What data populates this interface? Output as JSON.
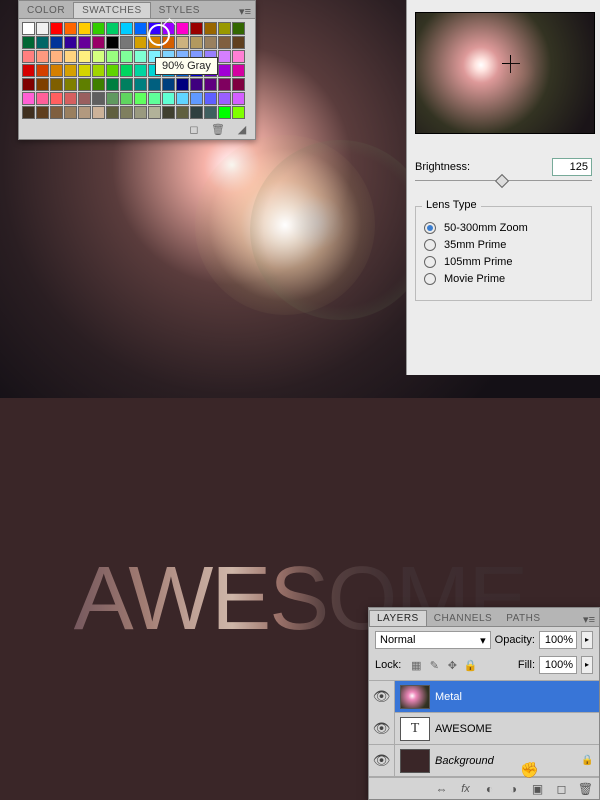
{
  "swatches": {
    "tabs": [
      "COLOR",
      "SWATCHES",
      "STYLES"
    ],
    "active_tab": 1,
    "tooltip": "90% Gray",
    "colors": [
      "#ffffff",
      "#f0f0f0",
      "#ff0000",
      "#ff6600",
      "#ffcc00",
      "#33cc00",
      "#00cc66",
      "#00ccff",
      "#0066ff",
      "#3300ff",
      "#9900ff",
      "#ff00cc",
      "#990000",
      "#996600",
      "#999900",
      "#336600",
      "#006633",
      "#006666",
      "#003399",
      "#330099",
      "#660099",
      "#990066",
      "#000000",
      "#777777",
      "#d4a000",
      "#d47f00",
      "#d45f00",
      "#ccb27f",
      "#b2995f",
      "#99805f",
      "#805f3f",
      "#5f3f1f",
      "#ff7f7f",
      "#ff997f",
      "#ffb27f",
      "#ffd47f",
      "#fff07f",
      "#d4ff7f",
      "#99ff7f",
      "#7fff99",
      "#7fffd4",
      "#7ff0ff",
      "#7fd4ff",
      "#7fb2ff",
      "#7f99ff",
      "#997fff",
      "#d47fff",
      "#ff7fd4",
      "#d40000",
      "#d43f00",
      "#d47f00",
      "#d4a000",
      "#d4d400",
      "#a0d400",
      "#5fd400",
      "#00d45f",
      "#00d4a0",
      "#00d4d4",
      "#00a0d4",
      "#005fd4",
      "#0000d4",
      "#5f00d4",
      "#a000d4",
      "#d400a0",
      "#7f0000",
      "#7f3f00",
      "#7f5f00",
      "#7f7f00",
      "#5f7f00",
      "#3f7f00",
      "#007f3f",
      "#007f5f",
      "#007f7f",
      "#005f7f",
      "#003f7f",
      "#00007f",
      "#3f007f",
      "#5f007f",
      "#7f005f",
      "#7f003f",
      "#ff5fd4",
      "#ff5f99",
      "#ff5f5f",
      "#d45f5f",
      "#995f5f",
      "#5f5f5f",
      "#5f995f",
      "#5fd45f",
      "#5fff5f",
      "#5fff99",
      "#5fffd4",
      "#5fd4ff",
      "#5f99ff",
      "#5f5fff",
      "#995fff",
      "#d45fff",
      "#3f2f1f",
      "#5f3f1f",
      "#7f5f3f",
      "#997f5f",
      "#b2997f",
      "#ccb299",
      "#5f5f3f",
      "#7f7f5f",
      "#99997f",
      "#b2b299",
      "#3f3f2f",
      "#5f5f3f",
      "#2f3f3f",
      "#3f5f5f",
      "#00ff00",
      "#7fff00"
    ]
  },
  "flare": {
    "brightness_label": "Brightness:",
    "brightness_value": "125",
    "legend": "Lens Type",
    "options": [
      "50-300mm Zoom",
      "35mm Prime",
      "105mm Prime",
      "Movie Prime"
    ],
    "selected": 0
  },
  "awesome": "AWESOME",
  "layers": {
    "tabs": [
      "LAYERS",
      "CHANNELS",
      "PATHS"
    ],
    "active_tab": 0,
    "blend_mode": "Normal",
    "opacity_label": "Opacity:",
    "opacity_value": "100%",
    "lock_label": "Lock:",
    "fill_label": "Fill:",
    "fill_value": "100%",
    "items": [
      {
        "name": "Metal",
        "type": "flare",
        "selected": true
      },
      {
        "name": "AWESOME",
        "type": "text",
        "selected": false
      },
      {
        "name": "Background",
        "type": "bg",
        "selected": false,
        "locked": true,
        "italic": true
      }
    ]
  }
}
